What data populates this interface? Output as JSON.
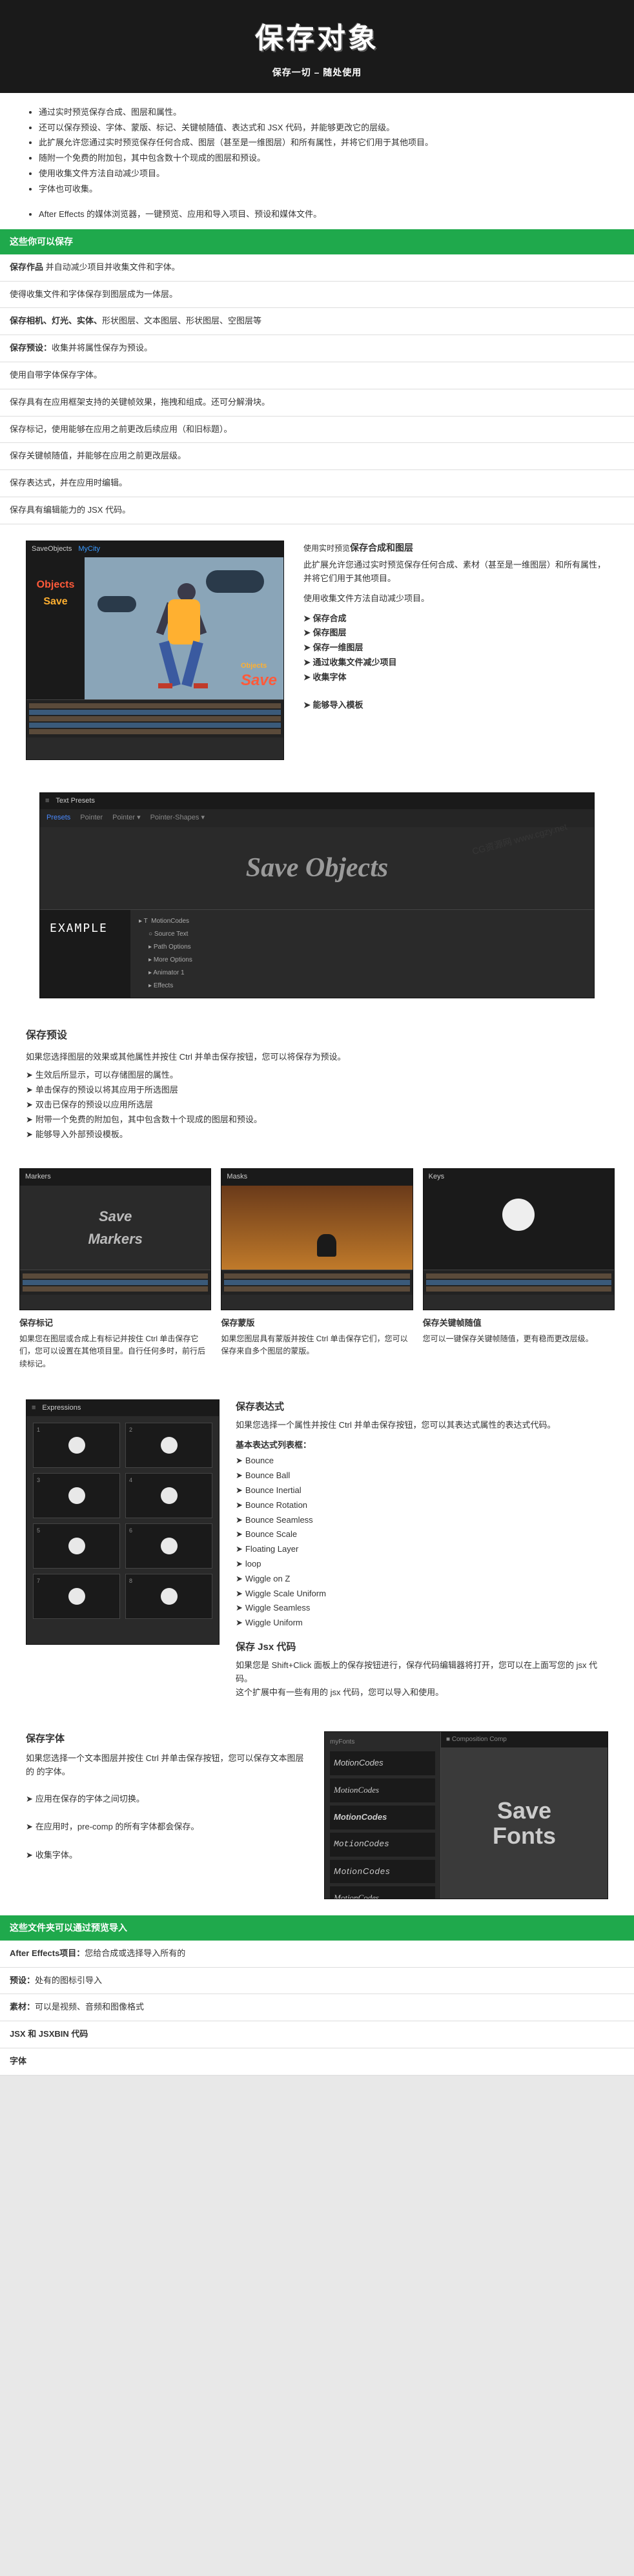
{
  "hero": {
    "title": "保存对象",
    "subtitle": "保存一切 – 随处使用"
  },
  "intro": {
    "bullets1": [
      "通过实时预览保存合成、图层和属性。",
      "还可以保存预设、字体、蒙版、标记、关键帧随值、表达式和 JSX 代码，并能够更改它的层级。",
      "此扩展允许您通过实时预览保存任何合成、图层（甚至是一维图层）和所有属性，并将它们用于其他项目。",
      "随附一个免费的附加包，其中包含数十个现成的图层和预设。",
      "使用收集文件方法自动减少项目。",
      "字体也可收集。"
    ],
    "bullets2": [
      "After Effects 的媒体浏览器，一键预览、应用和导入项目、预设和媒体文件。"
    ]
  },
  "greenBar1": "这些你可以保存",
  "features": [
    {
      "label": "保存作品",
      "text": "并自动减少项目并收集文件和字体。"
    },
    {
      "label": "",
      "text": "使得收集文件和字体保存到图层成为一体层。"
    },
    {
      "label": "保存相机、灯光、实体、",
      "text": "形状图层、文本图层、形状图层、空图层等"
    },
    {
      "label": "保存预设：",
      "text": "收集并将属性保存为预设。"
    },
    {
      "label": "",
      "text": "使用自带字体保存字体。"
    },
    {
      "label": "",
      "text": "保存具有在应用框架支持的关键帧效果，拖拽和组成。还可分解滑块。"
    },
    {
      "label": "",
      "text": "保存标记，使用能够在应用之前更改后续应用（和旧标题）。"
    },
    {
      "label": "",
      "text": "保存关键帧随值，并能够在应用之前更改层级。"
    },
    {
      "label": "",
      "text": "保存表达式，并在应用时编辑。"
    },
    {
      "label": "",
      "text": "保存具有编辑能力的 JSX 代码。"
    }
  ],
  "sec1": {
    "pre": "使用实时预览",
    "title": "保存合成和图层",
    "desc": "此扩展允许您通过实时预览保存任何合成、素材（甚至是一维图层）和所有属性，并将它们用于其他项目。",
    "use": "使用收集文件方法自动减少项目。",
    "list": [
      "保存合成",
      "保存图层",
      "保存一维图层",
      "通过收集文件减少项目",
      "收集字体"
    ],
    "extra": "能够导入模板",
    "tab1": "SaveObjects",
    "tab2": "MyCity",
    "leftWord1": "Objects",
    "leftWord2": "Save",
    "badgeSub": "Objects",
    "badgeMain": "Save"
  },
  "sec2": {
    "tabLabel": "Text Presets",
    "tabs": [
      "Presets",
      "Pointer",
      "Pointer ▾",
      "Pointer-Shapes ▾"
    ],
    "bigText": "Save Objects",
    "example": "EXAMPLE",
    "propsHeader": "MotionCodes",
    "props": [
      "Source Text",
      "Path Options",
      "More Options",
      "Animator 1",
      "Effects"
    ],
    "title": "保存预设",
    "desc": "如果您选择图层的效果或其他属性并按住 Ctrl 并单击保存按钮，您可以将保存为预设。",
    "list": [
      "生效后所显示，可以存储图层的属性。",
      "单击保存的预设以将其应用于所选图层",
      "双击已保存的预设以应用所选层",
      "附带一个免费的附加包，其中包含数十个现成的图层和预设。",
      "能够导入外部预设模板。"
    ]
  },
  "sec3": {
    "tab": "Markers",
    "markersText": "Save\nMarkers",
    "panels": [
      {
        "title": "保存标记",
        "text": "如果您在图层或合成上有标记并按住 Ctrl 单击保存它们，您可以设置在其他项目里。自行任何多时，前行后续标记。"
      },
      {
        "title": "保存蒙版",
        "text": "如果您图层具有蒙版并按住 Ctrl 单击保存它们，您可以保存来自多个图层的蒙版。"
      },
      {
        "title": "保存关键帧随值",
        "text": "您可以一键保存关键帧随值，更有稳而更改层级。"
      }
    ]
  },
  "sec4": {
    "tab": "Expressions",
    "title": "保存表达式",
    "desc": "如果您选择一个属性并按住 Ctrl 并单击保存按钮，您可以其表达式属性的表达式代码。",
    "subTitle": "基本表达式列表框：",
    "exprList": [
      "Bounce",
      "Bounce Ball",
      "Bounce Inertial",
      "Bounce Rotation",
      "Bounce Seamless",
      "Bounce Scale",
      "Floating Layer",
      "loop",
      "Wiggle on Z",
      "Wiggle Scale Uniform",
      "Wiggle Seamless",
      "Wiggle Uniform"
    ],
    "jsxTitle": "保存 Jsx 代码",
    "jsxDesc": "如果您是 Shift+Click 面板上的保存按钮进行，保存代码编辑器将打开，您可以在上面写您的 jsx 代码。",
    "jsxNote": "这个扩展中有一些有用的 jsx 代码，您可以导入和使用。"
  },
  "sec5": {
    "title": "保存字体",
    "desc": "如果您选择一个文本图层并按住 Ctrl 并单击保存按钮，您可以保存文本图层的 的字体。",
    "list": [
      "应用在保存的字体之间切换。",
      "在应用时，pre-comp 的所有字体都会保存。",
      "收集字体。"
    ],
    "tabL": "myFonts",
    "tabR": "Composition Comp",
    "fontName": "MotionCodes",
    "canvasText": "Save\nFonts"
  },
  "greenBar2": "这些文件夹可以通过预览导入",
  "footer": [
    {
      "label": "After Effects项目：",
      "text": "您给合成或选择导入所有的"
    },
    {
      "label": "预设：",
      "text": "处有的图标引导入"
    },
    {
      "label": "素材：",
      "text": "可以是视频、音频和图像格式"
    },
    {
      "label": "JSX 和 JSXBIN 代码",
      "text": ""
    },
    {
      "label": "字体",
      "text": ""
    }
  ]
}
